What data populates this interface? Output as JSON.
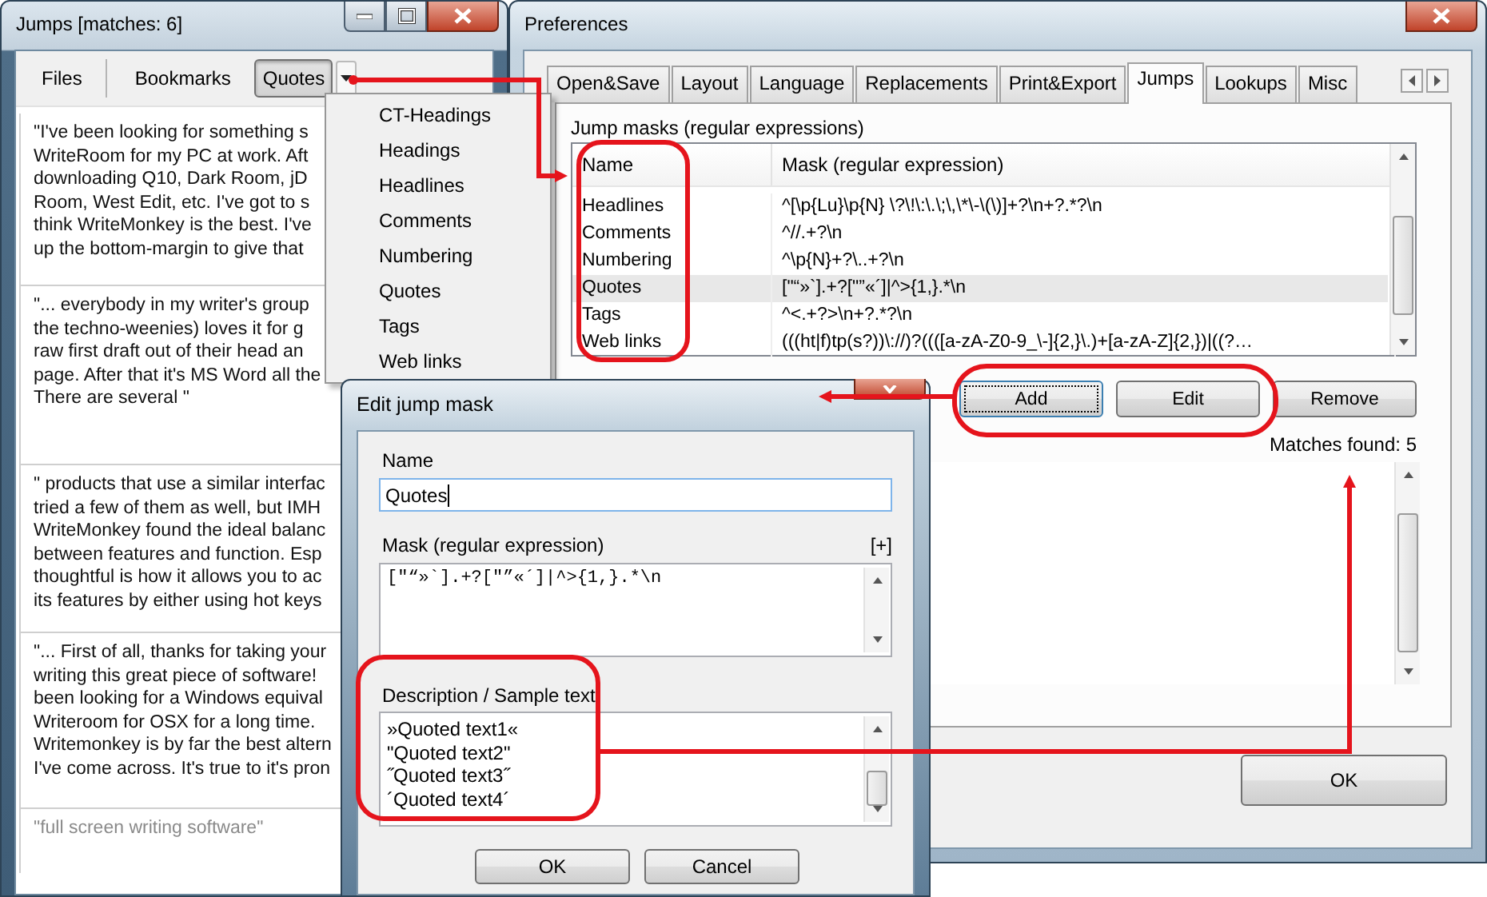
{
  "jumps_window": {
    "title": "Jumps [matches: 6]",
    "toolbar": [
      {
        "label": "Files",
        "selected": false
      },
      {
        "label": "Bookmarks",
        "selected": false
      },
      {
        "label": "Quotes",
        "selected": true
      }
    ],
    "cards": [
      {
        "lines": [
          "\"I've been looking for something s",
          "WriteRoom for my PC at work. Aft",
          "downloading Q10, Dark Room, jD",
          "Room, West Edit, etc. I've got to s",
          "think WriteMonkey is the best. I've",
          "up the bottom-margin to give that"
        ],
        "dimmed": false
      },
      {
        "lines": [
          "\"... everybody in my writer's group",
          "the techno-weenies) loves it for g",
          "raw first draft out of their head an",
          "page. After that it's MS Word all the",
          "There are several \""
        ],
        "dimmed": false
      },
      {
        "lines": [
          "\" products that use a similar interfac",
          "tried a few of them as well, but IMH",
          "WriteMonkey found the ideal balanc",
          "between features and function. Esp",
          "thoughtful is how it allows you to ac",
          "its features by either using hot keys"
        ],
        "dimmed": false
      },
      {
        "lines": [
          "\"... First of all, thanks for taking your",
          "writing this great piece of software!",
          "been looking for a Windows equival",
          "Writeroom for OSX for a long time.",
          "Writemonkey is by far the best altern",
          "I've come across. It's true to it's pron"
        ],
        "dimmed": false
      },
      {
        "lines": [
          "\"full screen writing software\""
        ],
        "dimmed": true
      }
    ]
  },
  "dropdown_menu": {
    "items": [
      "CT-Headings",
      "Headings",
      "Headlines",
      "Comments",
      "Numbering",
      "Quotes",
      "Tags",
      "Web links"
    ]
  },
  "preferences": {
    "title": "Preferences",
    "tabs": [
      {
        "label": "Open&Save",
        "selected": false
      },
      {
        "label": "Layout",
        "selected": false
      },
      {
        "label": "Language",
        "selected": false
      },
      {
        "label": "Replacements",
        "selected": false
      },
      {
        "label": "Print&Export",
        "selected": false
      },
      {
        "label": "Jumps",
        "selected": true
      },
      {
        "label": "Lookups",
        "selected": false
      },
      {
        "label": "Misc",
        "selected": false
      }
    ],
    "group_label": "Jump masks (regular expressions)",
    "table": {
      "columns": [
        "Name",
        "Mask (regular expression)"
      ],
      "rows": [
        {
          "name": "Headlines",
          "mask": "^[\\p{Lu}\\p{N} \\?\\!\\:\\.\\;\\,\\*\\-\\(\\)]+?\\n+?.*?\\n",
          "selected": false
        },
        {
          "name": "Comments",
          "mask": "^//.+?\\n",
          "selected": false
        },
        {
          "name": "Numbering",
          "mask": "^\\p{N}+?\\..+?\\n",
          "selected": false
        },
        {
          "name": "Quotes",
          "mask": "[\"“»`].+?[\"”«´]|^>{1,}.*\\n",
          "selected": true
        },
        {
          "name": "Tags",
          "mask": "^<.+?>\\n+?.*?\\n",
          "selected": false
        },
        {
          "name": "Web links",
          "mask": "(((ht|f)tp(s?))\\://)?((([a-zA-Z0-9_\\-]{2,}\\.)+[a-zA-Z]{2,})|((?…",
          "selected": false
        }
      ]
    },
    "buttons": [
      {
        "label": "Add",
        "focused": true
      },
      {
        "label": "Edit",
        "focused": false
      },
      {
        "label": "Remove",
        "focused": false
      }
    ],
    "matches_found": "Matches found: 5",
    "ok_button": "OK"
  },
  "edit_dialog": {
    "title": "Edit jump mask",
    "name_label": "Name",
    "name_value": "Quotes",
    "mask_label": "Mask (regular expression)",
    "expand_button": "[+]",
    "mask_value": "[\"“»`].+?[\"”«´]|^>{1,}.*\\n",
    "description_label": "Description / Sample text",
    "description_lines": [
      "»Quoted text1«",
      "\"Quoted text2\"",
      "˝Quoted text3˝",
      "´Quoted text4´"
    ],
    "buttons": [
      "OK",
      "Cancel"
    ]
  }
}
